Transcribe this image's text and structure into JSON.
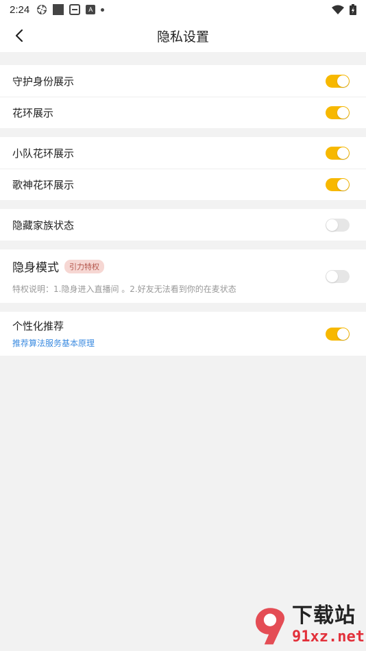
{
  "status_bar": {
    "time": "2:24",
    "a_icon_letter": "A"
  },
  "header": {
    "title": "隐私设置"
  },
  "group1": [
    {
      "label": "守护身份展示",
      "on": true
    },
    {
      "label": "花环展示",
      "on": true
    }
  ],
  "group2": [
    {
      "label": "小队花环展示",
      "on": true
    },
    {
      "label": "歌神花环展示",
      "on": true
    }
  ],
  "group3": [
    {
      "label": "隐藏家族状态",
      "on": false
    }
  ],
  "stealth": {
    "title": "隐身模式",
    "badge": "引力特权",
    "desc": "特权说明：1.隐身进入直播间 。2.好友无法看到你的在麦状态",
    "on": false
  },
  "personal": {
    "title": "个性化推荐",
    "link": "推荐算法服务基本原理",
    "on": true
  },
  "watermark": {
    "big": "下载站",
    "small": "91xz.net"
  },
  "colors": {
    "toggle_on": "#f7b800",
    "toggle_off": "#e6e6e6",
    "link": "#3b8be0",
    "badge_bg": "#f6d7d3"
  }
}
